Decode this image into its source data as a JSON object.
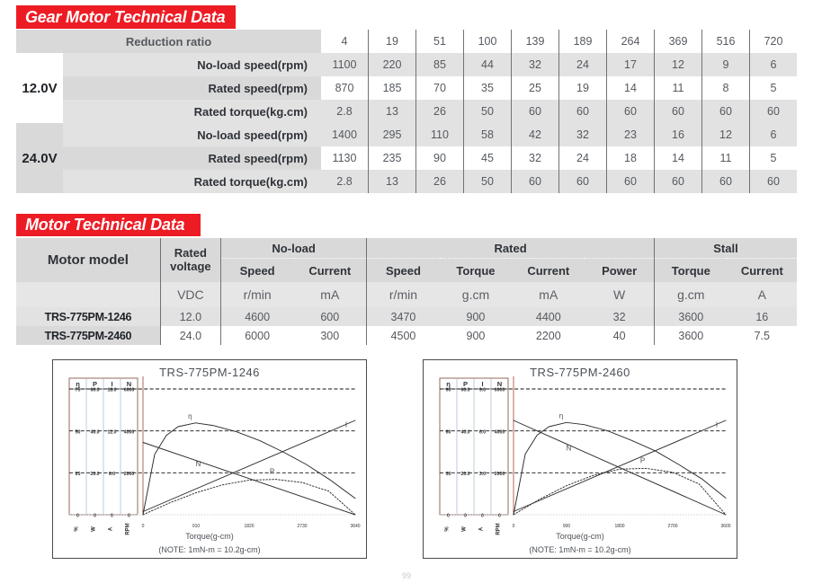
{
  "gear_section": {
    "banner_title": "Gear Motor Technical Data",
    "ratio_label": "Reduction ratio",
    "ratios": [
      "4",
      "19",
      "51",
      "100",
      "139",
      "189",
      "264",
      "369",
      "516",
      "720"
    ],
    "groups": [
      {
        "voltage": "12.0V",
        "rows": [
          {
            "label": "No-load speed(rpm)",
            "values": [
              "1100",
              "220",
              "85",
              "44",
              "32",
              "24",
              "17",
              "12",
              "9",
              "6"
            ]
          },
          {
            "label": "Rated speed(rpm)",
            "values": [
              "870",
              "185",
              "70",
              "35",
              "25",
              "19",
              "14",
              "11",
              "8",
              "5"
            ]
          },
          {
            "label": "Rated torque(kg.cm)",
            "values": [
              "2.8",
              "13",
              "26",
              "50",
              "60",
              "60",
              "60",
              "60",
              "60",
              "60"
            ]
          }
        ]
      },
      {
        "voltage": "24.0V",
        "rows": [
          {
            "label": "No-load speed(rpm)",
            "values": [
              "1400",
              "295",
              "110",
              "58",
              "42",
              "32",
              "23",
              "16",
              "12",
              "6"
            ]
          },
          {
            "label": "Rated speed(rpm)",
            "values": [
              "1130",
              "235",
              "90",
              "45",
              "32",
              "24",
              "18",
              "14",
              "11",
              "5"
            ]
          },
          {
            "label": "Rated torque(kg.cm)",
            "values": [
              "2.8",
              "13",
              "26",
              "50",
              "60",
              "60",
              "60",
              "60",
              "60",
              "60"
            ]
          }
        ]
      }
    ]
  },
  "motor_section": {
    "banner_title": "Motor Technical Data",
    "col_model": "Motor model",
    "col_rated_voltage": "Rated voltage",
    "group_noload": "No-load",
    "group_rated": "Rated",
    "group_stall": "Stall",
    "sub_headers": [
      "Speed",
      "Current",
      "Speed",
      "Torque",
      "Current",
      "Power",
      "Torque",
      "Current"
    ],
    "units": [
      "VDC",
      "r/min",
      "mA",
      "r/min",
      "g.cm",
      "mA",
      "W",
      "g.cm",
      "A"
    ],
    "rows": [
      {
        "model": "TRS-775PM-1246",
        "values": [
          "12.0",
          "4600",
          "600",
          "3470",
          "900",
          "4400",
          "32",
          "3600",
          "16"
        ]
      },
      {
        "model": "TRS-775PM-2460",
        "values": [
          "24.0",
          "6000",
          "300",
          "4500",
          "900",
          "2200",
          "40",
          "3600",
          "7.5"
        ]
      }
    ]
  },
  "charts": [
    {
      "title": "TRS-775PM-1246",
      "axis_columns": [
        {
          "symbol": "η",
          "unit": "%",
          "ticks": [
            "75",
            "50",
            "25",
            "0"
          ]
        },
        {
          "symbol": "P",
          "unit": "W",
          "ticks": [
            "60.0",
            "40.0",
            "20.0",
            "0"
          ]
        },
        {
          "symbol": "I",
          "unit": "A",
          "ticks": [
            "18.0",
            "12.0",
            "6.0",
            "0"
          ]
        },
        {
          "symbol": "N",
          "unit": "RPM",
          "ticks": [
            "6000",
            "4000",
            "2000",
            "0"
          ]
        }
      ],
      "x_ticks": [
        "0",
        "910",
        "1820",
        "2730",
        "3640"
      ],
      "xlabel": "Torque(g-cm)",
      "note": "(NOTE: 1mN-m = 10.2g-cm)",
      "curve_labels": {
        "eta": "η",
        "speed": "N",
        "power": "P",
        "current": "I"
      }
    },
    {
      "title": "TRS-775PM-2460",
      "axis_columns": [
        {
          "symbol": "η",
          "unit": "%",
          "ticks": [
            "90",
            "60",
            "30",
            "0"
          ]
        },
        {
          "symbol": "P",
          "unit": "W",
          "ticks": [
            "60.0",
            "40.0",
            "20.0",
            "0"
          ]
        },
        {
          "symbol": "I",
          "unit": "A",
          "ticks": [
            "9.0",
            "6.0",
            "3.0",
            "0"
          ]
        },
        {
          "symbol": "N",
          "unit": "RPM",
          "ticks": [
            "6000",
            "4000",
            "2000",
            "0"
          ]
        }
      ],
      "x_ticks": [
        "0",
        "900",
        "1800",
        "2700",
        "3600"
      ],
      "xlabel": "Torque(g-cm)",
      "note": "(NOTE: 1mN-m = 10.2g-cm)",
      "curve_labels": {
        "eta": "η",
        "speed": "N",
        "power": "P",
        "current": "I"
      }
    }
  ],
  "chart_data": [
    {
      "type": "line",
      "title": "TRS-775PM-1246",
      "xlabel": "Torque(g-cm)",
      "xlim": [
        0,
        3640
      ],
      "x_ticks": [
        0,
        910,
        1820,
        2730,
        3640
      ],
      "grid": false,
      "legend": "inline-curve-labels",
      "note": "(NOTE: 1mN-m = 10.2g-cm)",
      "series": [
        {
          "name": "η",
          "axis": "Efficiency (%)",
          "ylim": [
            0,
            100
          ],
          "y_ticks": [
            0,
            25,
            50,
            75
          ],
          "x": [
            0,
            200,
            400,
            600,
            900,
            1200,
            1600,
            2000,
            2400,
            2800,
            3200,
            3640
          ],
          "values": [
            0,
            48,
            63,
            70,
            73,
            71,
            66,
            59,
            50,
            40,
            28,
            13
          ]
        },
        {
          "name": "N",
          "axis": "Speed (RPM)",
          "ylim": [
            0,
            8000
          ],
          "y_ticks": [
            0,
            2000,
            4000,
            6000
          ],
          "x": [
            0,
            3640
          ],
          "values": [
            4600,
            0
          ]
        },
        {
          "name": "P",
          "axis": "Power (W)",
          "ylim": [
            0,
            80
          ],
          "y_ticks": [
            0,
            20.0,
            40.0,
            60.0
          ],
          "x": [
            0,
            455,
            910,
            1365,
            1820,
            2275,
            2730,
            3185,
            3640
          ],
          "values": [
            0,
            7.5,
            14.0,
            19.0,
            22.0,
            22.5,
            20.5,
            15.0,
            0
          ]
        },
        {
          "name": "I",
          "axis": "Current (A)",
          "ylim": [
            0,
            24
          ],
          "y_ticks": [
            0,
            6.0,
            12.0,
            18.0
          ],
          "x": [
            0,
            3640
          ],
          "values": [
            0.6,
            18.0
          ]
        }
      ]
    },
    {
      "type": "line",
      "title": "TRS-775PM-2460",
      "xlabel": "Torque(g-cm)",
      "xlim": [
        0,
        3600
      ],
      "x_ticks": [
        0,
        900,
        1800,
        2700,
        3600
      ],
      "grid": false,
      "legend": "inline-curve-labels",
      "note": "(NOTE: 1mN-m = 10.2g-cm)",
      "series": [
        {
          "name": "η",
          "axis": "Efficiency (%)",
          "ylim": [
            0,
            120
          ],
          "y_ticks": [
            0,
            30,
            60,
            90
          ],
          "x": [
            0,
            200,
            400,
            600,
            900,
            1200,
            1600,
            2000,
            2400,
            2800,
            3200,
            3600
          ],
          "values": [
            0,
            58,
            76,
            84,
            88,
            86,
            80,
            71,
            61,
            48,
            34,
            16
          ]
        },
        {
          "name": "N",
          "axis": "Speed (RPM)",
          "ylim": [
            0,
            8000
          ],
          "y_ticks": [
            0,
            2000,
            4000,
            6000
          ],
          "x": [
            0,
            3600
          ],
          "values": [
            6000,
            0
          ]
        },
        {
          "name": "P",
          "axis": "Power (W)",
          "ylim": [
            0,
            80
          ],
          "y_ticks": [
            0,
            20.0,
            40.0,
            60.0
          ],
          "x": [
            0,
            450,
            900,
            1350,
            1800,
            2250,
            2700,
            3150,
            3600
          ],
          "values": [
            0,
            10.0,
            18.5,
            25.0,
            29.0,
            29.5,
            27.0,
            19.5,
            0
          ]
        },
        {
          "name": "I",
          "axis": "Current (A)",
          "ylim": [
            0,
            12
          ],
          "y_ticks": [
            0,
            3.0,
            6.0,
            9.0
          ],
          "x": [
            0,
            3600
          ],
          "values": [
            0.3,
            9.0
          ]
        }
      ]
    }
  ],
  "page_number": "99",
  "theme": {
    "accent_red": "#ED1C24",
    "shade_light": "#e2e2e2",
    "shade_mid": "#d9d9d9",
    "text": "#55595f"
  }
}
